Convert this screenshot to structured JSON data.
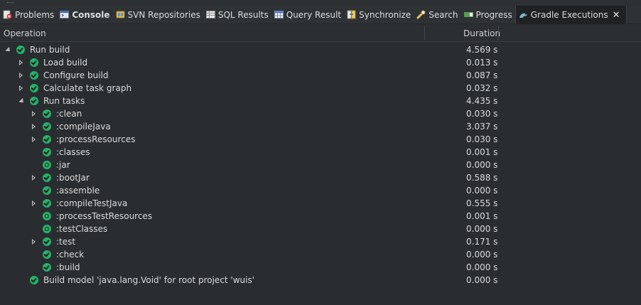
{
  "tabs": [
    {
      "label": "Problems",
      "icon": "problems-icon",
      "active": false,
      "bold": false
    },
    {
      "label": "Console",
      "icon": "console-icon",
      "active": false,
      "bold": true
    },
    {
      "label": "SVN Repositories",
      "icon": "svn-repositories-icon",
      "active": false,
      "bold": false
    },
    {
      "label": "SQL Results",
      "icon": "sql-results-icon",
      "active": false,
      "bold": false
    },
    {
      "label": "Query Result",
      "icon": "query-result-icon",
      "active": false,
      "bold": false
    },
    {
      "label": "Synchronize",
      "icon": "synchronize-icon",
      "active": false,
      "bold": false
    },
    {
      "label": "Search",
      "icon": "search-icon",
      "active": false,
      "bold": false
    },
    {
      "label": "Progress",
      "icon": "progress-icon",
      "active": false,
      "bold": false
    },
    {
      "label": "Gradle Executions",
      "icon": "gradle-icon",
      "active": true,
      "bold": false
    }
  ],
  "close_glyph": "✕",
  "columns": {
    "operation": "Operation",
    "duration": "Duration"
  },
  "rows": [
    {
      "label": "Run build",
      "duration": "4.569 s",
      "level": 0,
      "toggle": "expanded",
      "status": "success"
    },
    {
      "label": "Load build",
      "duration": "0.013 s",
      "level": 1,
      "toggle": "collapsed",
      "status": "success"
    },
    {
      "label": "Configure build",
      "duration": "0.087 s",
      "level": 1,
      "toggle": "collapsed",
      "status": "success"
    },
    {
      "label": "Calculate task graph",
      "duration": "0.032 s",
      "level": 1,
      "toggle": "collapsed",
      "status": "success"
    },
    {
      "label": "Run tasks",
      "duration": "4.435 s",
      "level": 1,
      "toggle": "expanded",
      "status": "success"
    },
    {
      "label": ":clean",
      "duration": "0.030 s",
      "level": 2,
      "toggle": "collapsed",
      "status": "success"
    },
    {
      "label": ":compileJava",
      "duration": "3.037 s",
      "level": 2,
      "toggle": "collapsed",
      "status": "success"
    },
    {
      "label": ":processResources",
      "duration": "0.030 s",
      "level": 2,
      "toggle": "collapsed",
      "status": "success"
    },
    {
      "label": ":classes",
      "duration": "0.001 s",
      "level": 2,
      "toggle": "none",
      "status": "success"
    },
    {
      "label": ":jar",
      "duration": "0.000 s",
      "level": 2,
      "toggle": "none",
      "status": "up-to-date"
    },
    {
      "label": ":bootJar",
      "duration": "0.588 s",
      "level": 2,
      "toggle": "collapsed",
      "status": "success"
    },
    {
      "label": ":assemble",
      "duration": "0.000 s",
      "level": 2,
      "toggle": "none",
      "status": "success"
    },
    {
      "label": ":compileTestJava",
      "duration": "0.555 s",
      "level": 2,
      "toggle": "collapsed",
      "status": "success"
    },
    {
      "label": ":processTestResources",
      "duration": "0.001 s",
      "level": 2,
      "toggle": "none",
      "status": "up-to-date"
    },
    {
      "label": ":testClasses",
      "duration": "0.000 s",
      "level": 2,
      "toggle": "none",
      "status": "up-to-date"
    },
    {
      "label": ":test",
      "duration": "0.171 s",
      "level": 2,
      "toggle": "collapsed",
      "status": "success"
    },
    {
      "label": ":check",
      "duration": "0.000 s",
      "level": 2,
      "toggle": "none",
      "status": "success"
    },
    {
      "label": ":build",
      "duration": "0.000 s",
      "level": 2,
      "toggle": "none",
      "status": "success"
    },
    {
      "label": "Build model 'java.lang.Void' for root project 'wuis'",
      "duration": "0.000 s",
      "level": 1,
      "toggle": "none",
      "status": "success"
    }
  ],
  "colors": {
    "background": "#2a2d30",
    "success": "#25b26a",
    "text": "#dadada"
  }
}
